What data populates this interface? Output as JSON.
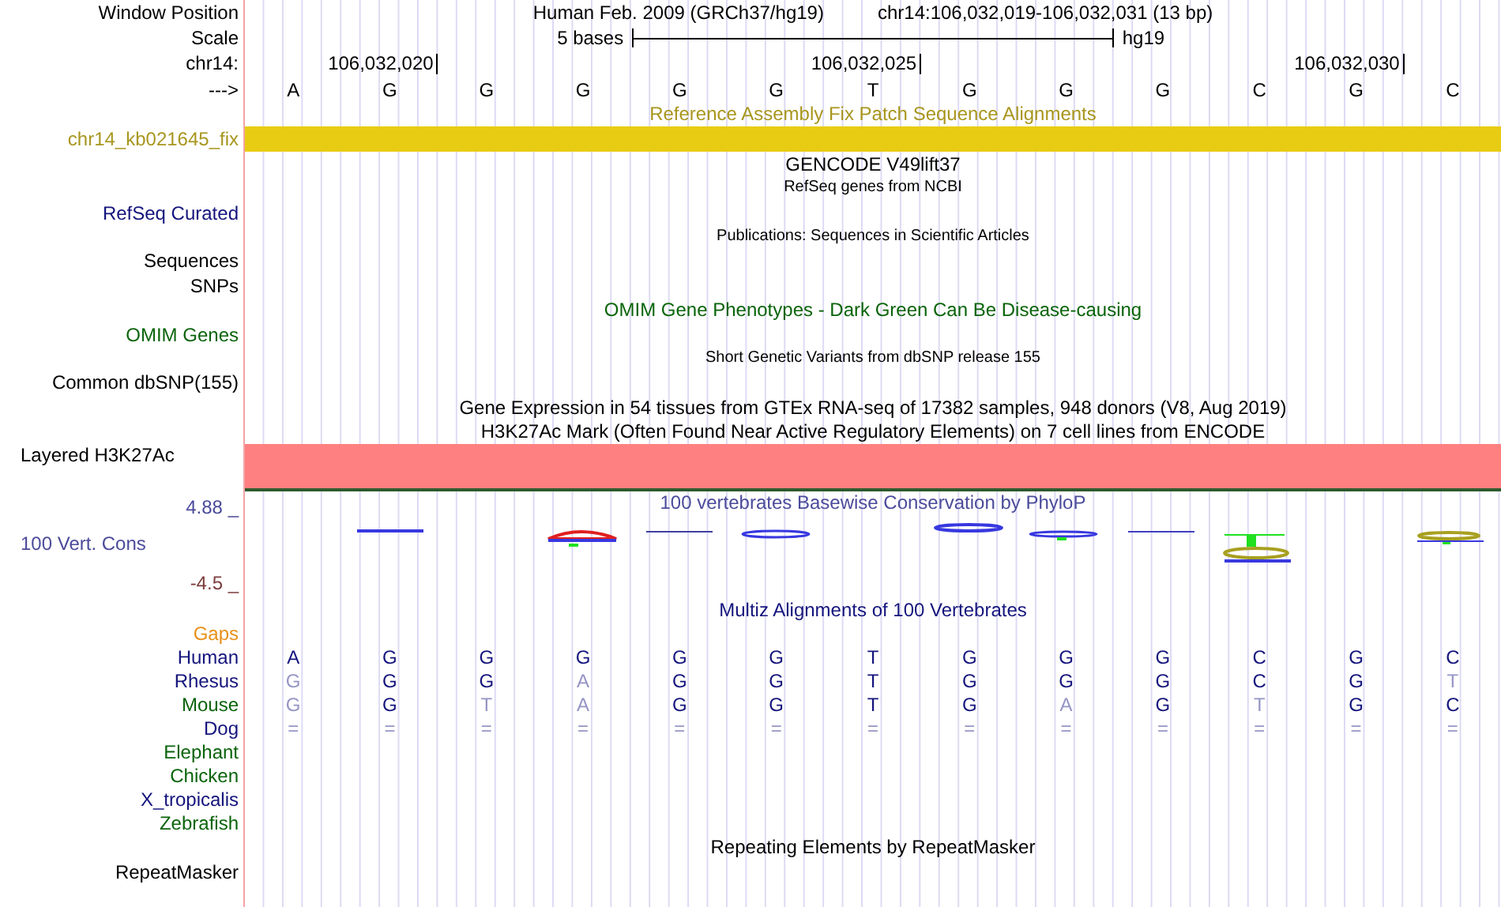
{
  "rows": [
    {
      "kind": "position",
      "label": "Window Position",
      "assembly": "Human Feb. 2009 (GRCh37/hg19)",
      "range": "chr14:106,032,019-106,032,031 (13 bp)"
    },
    {
      "kind": "scale",
      "label": "Scale",
      "span": "5 bases",
      "db": "hg19"
    },
    {
      "kind": "ruler",
      "label": "chr14:",
      "ticks": [
        "106,032,020",
        "106,032,025",
        "106,032,030"
      ]
    },
    {
      "kind": "bases",
      "label": "--->",
      "bases": [
        "A",
        "G",
        "G",
        "G",
        "G",
        "G",
        "T",
        "G",
        "G",
        "G",
        "C",
        "G",
        "C"
      ]
    },
    {
      "kind": "title",
      "text": "Reference Assembly Fix Patch Sequence Alignments",
      "color": "#a8961e"
    },
    {
      "kind": "bar",
      "label": "chr14_kb021645_fix",
      "color": "#a8961e",
      "bar": {
        "color": "#e8cc14"
      }
    },
    {
      "kind": "title",
      "text": "GENCODE V49lift37",
      "color": "#000000"
    },
    {
      "kind": "subtitle",
      "text": "RefSeq genes from NCBI"
    },
    {
      "kind": "label",
      "label": "RefSeq Curated",
      "color": "#14147d"
    },
    {
      "kind": "subtitle",
      "text": "Publications: Sequences in Scientific Articles"
    },
    {
      "kind": "label",
      "label": "Sequences",
      "color": "#000000"
    },
    {
      "kind": "label",
      "label": "SNPs",
      "color": "#000000"
    },
    {
      "kind": "title",
      "text": "OMIM Gene Phenotypes - Dark Green Can Be Disease-causing",
      "color": "#0a640a"
    },
    {
      "kind": "label",
      "label": "OMIM Genes",
      "color": "#0a640a"
    },
    {
      "kind": "subtitle",
      "text": "Short Genetic Variants from dbSNP release 155"
    },
    {
      "kind": "label",
      "label": "Common dbSNP(155)",
      "color": "#000000"
    },
    {
      "kind": "title",
      "text": "Gene Expression in 54 tissues from GTEx RNA-seq of 17382 samples, 948 donors (V8, Aug 2019)",
      "color": "#000000"
    },
    {
      "kind": "title",
      "text": "H3K27Ac Mark (Often Found Near Active Regulatory Elements) on 7 cell lines from ENCODE",
      "color": "#000000"
    },
    {
      "kind": "layered",
      "label": "Layered H3K27Ac",
      "color": "#000000",
      "bar": {
        "color": "#ff8080"
      }
    },
    {
      "kind": "wiggle",
      "title": "100 vertebrates Basewise Conservation by PhyloP",
      "label": "100 Vert. Cons",
      "color": "#4b4b9b",
      "max": {
        "text": "4.88 _",
        "color": "#4b4b9b"
      },
      "min": {
        "text": "-4.5 _",
        "color": "#7d3c3c"
      }
    },
    {
      "kind": "title",
      "text": "Multiz Alignments of 100 Vertebrates",
      "color": "#14147d"
    },
    {
      "kind": "label",
      "label": "Gaps",
      "color": "#e8901a"
    },
    {
      "kind": "species",
      "label": "Human",
      "color": "#14147d",
      "bases": [
        {
          "base": "A",
          "differs": false
        },
        {
          "base": "G",
          "differs": false
        },
        {
          "base": "G",
          "differs": false
        },
        {
          "base": "G",
          "differs": false
        },
        {
          "base": "G",
          "differs": false
        },
        {
          "base": "G",
          "differs": false
        },
        {
          "base": "T",
          "differs": false
        },
        {
          "base": "G",
          "differs": false
        },
        {
          "base": "G",
          "differs": false
        },
        {
          "base": "G",
          "differs": false
        },
        {
          "base": "C",
          "differs": false
        },
        {
          "base": "G",
          "differs": false
        },
        {
          "base": "C",
          "differs": false
        }
      ]
    },
    {
      "kind": "species",
      "label": "Rhesus",
      "color": "#14147d",
      "bases": [
        {
          "base": "G",
          "differs": true
        },
        {
          "base": "G",
          "differs": false
        },
        {
          "base": "G",
          "differs": false
        },
        {
          "base": "A",
          "differs": true
        },
        {
          "base": "G",
          "differs": false
        },
        {
          "base": "G",
          "differs": false
        },
        {
          "base": "T",
          "differs": false
        },
        {
          "base": "G",
          "differs": false
        },
        {
          "base": "G",
          "differs": false
        },
        {
          "base": "G",
          "differs": false
        },
        {
          "base": "C",
          "differs": false
        },
        {
          "base": "G",
          "differs": false
        },
        {
          "base": "T",
          "differs": true
        }
      ]
    },
    {
      "kind": "species",
      "label": "Mouse",
      "color": "#0a640a",
      "bases": [
        {
          "base": "G",
          "differs": true
        },
        {
          "base": "G",
          "differs": false
        },
        {
          "base": "T",
          "differs": true
        },
        {
          "base": "A",
          "differs": true
        },
        {
          "base": "G",
          "differs": false
        },
        {
          "base": "G",
          "differs": false
        },
        {
          "base": "T",
          "differs": false
        },
        {
          "base": "G",
          "differs": false
        },
        {
          "base": "A",
          "differs": true
        },
        {
          "base": "G",
          "differs": false
        },
        {
          "base": "T",
          "differs": true
        },
        {
          "base": "G",
          "differs": false
        },
        {
          "base": "C",
          "differs": false
        }
      ]
    },
    {
      "kind": "species",
      "label": "Dog",
      "color": "#14147d",
      "bases": [
        {
          "base": "=",
          "differs": true
        },
        {
          "base": "=",
          "differs": true
        },
        {
          "base": "=",
          "differs": true
        },
        {
          "base": "=",
          "differs": true
        },
        {
          "base": "=",
          "differs": true
        },
        {
          "base": "=",
          "differs": true
        },
        {
          "base": "=",
          "differs": true
        },
        {
          "base": "=",
          "differs": true
        },
        {
          "base": "=",
          "differs": true
        },
        {
          "base": "=",
          "differs": true
        },
        {
          "base": "=",
          "differs": true
        },
        {
          "base": "=",
          "differs": true
        },
        {
          "base": "=",
          "differs": true
        }
      ]
    },
    {
      "kind": "species",
      "label": "Elephant",
      "color": "#0a640a"
    },
    {
      "kind": "species",
      "label": "Chicken",
      "color": "#0a640a"
    },
    {
      "kind": "species",
      "label": "X_tropicalis",
      "color": "#14147d"
    },
    {
      "kind": "species",
      "label": "Zebrafish",
      "color": "#0a640a"
    },
    {
      "kind": "title",
      "text": "Repeating Elements by RepeatMasker",
      "color": "#000000"
    },
    {
      "kind": "label",
      "label": "RepeatMasker",
      "color": "#000000"
    }
  ]
}
